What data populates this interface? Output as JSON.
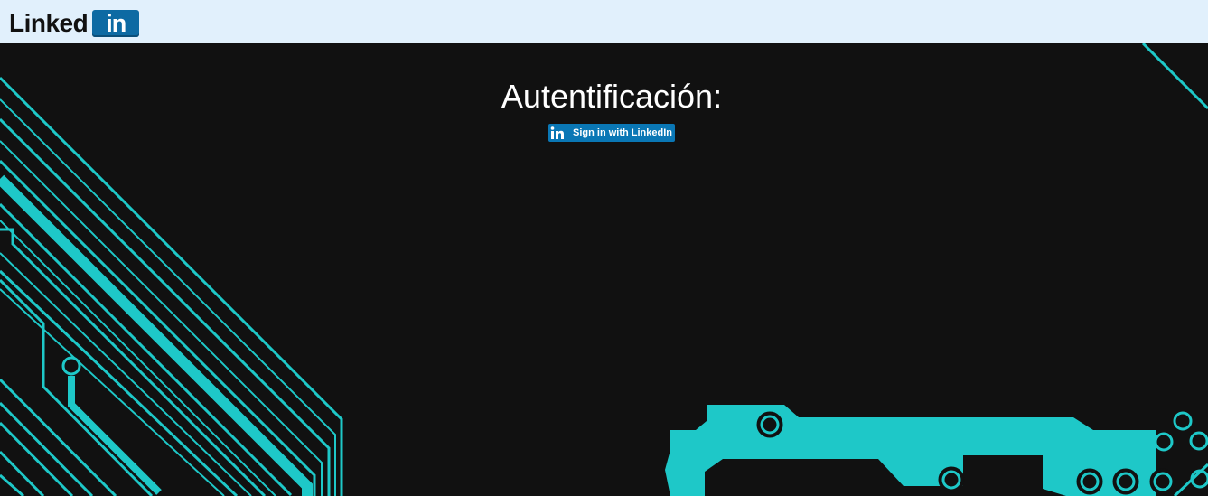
{
  "header": {
    "logo_word": "Linked",
    "logo_box": "in"
  },
  "main": {
    "title": "Autentificación:",
    "signin_label": "Sign in with LinkedIn",
    "signin_icon_text": "in"
  },
  "colors": {
    "header_bg": "#e1f0fc",
    "page_bg": "#111111",
    "circuit": "#1ec8c8",
    "linkedin_blue": "#0a77b5"
  },
  "icons": [
    "linkedin-logo",
    "linkedin-in-icon",
    "circuit-background"
  ]
}
